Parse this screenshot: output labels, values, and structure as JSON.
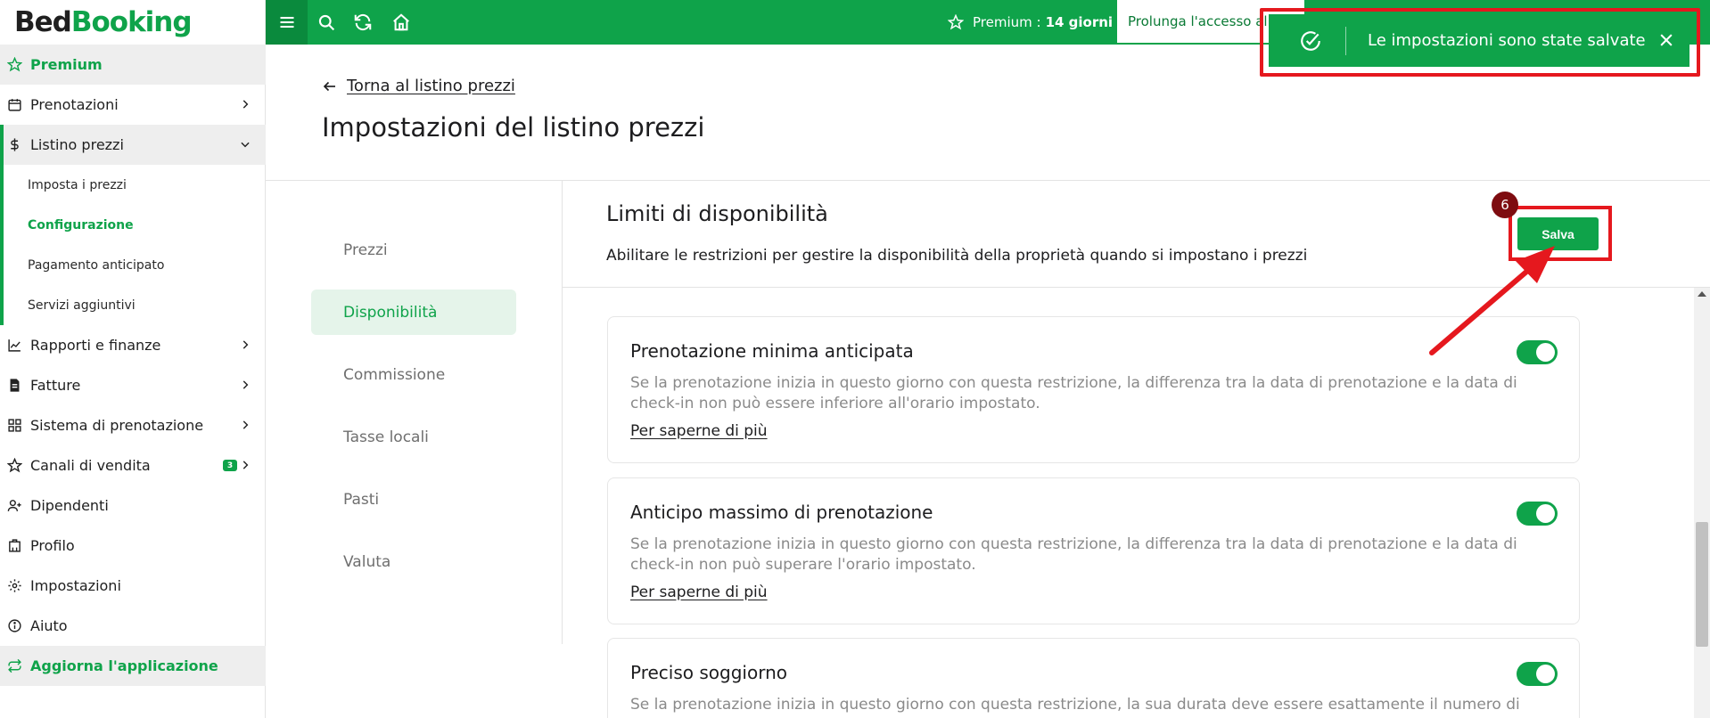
{
  "logo": {
    "part1": "Bed",
    "part2": "Booking"
  },
  "sidebar": {
    "premium": "Premium",
    "items": [
      {
        "label": "Prenotazioni",
        "icon": "calendar-icon"
      },
      {
        "label": "Listino prezzi",
        "icon": "dollar-icon"
      },
      {
        "label": "Rapporti e finanze",
        "icon": "chart-icon"
      },
      {
        "label": "Fatture",
        "icon": "invoice-icon"
      },
      {
        "label": "Sistema di prenotazione",
        "icon": "grid-icon"
      },
      {
        "label": "Canali di vendita",
        "icon": "star-icon",
        "badge": "3"
      },
      {
        "label": "Dipendenti",
        "icon": "user-add-icon"
      },
      {
        "label": "Profilo",
        "icon": "building-icon"
      },
      {
        "label": "Impostazioni",
        "icon": "gear-icon"
      },
      {
        "label": "Aiuto",
        "icon": "info-icon"
      }
    ],
    "subitems": [
      "Imposta i prezzi",
      "Configurazione",
      "Pagamento anticipato",
      "Servizi aggiuntivi"
    ],
    "update": "Aggiorna l'applicazione"
  },
  "topbar": {
    "premium_label": "Premium :",
    "premium_days": "14 giorni",
    "extend_button": "Prolunga l'accesso al co"
  },
  "toast": {
    "message": "Le impostazioni sono state salvate"
  },
  "page": {
    "back_link": "Torna al listino prezzi",
    "title": "Impostazioni del listino prezzi"
  },
  "settings_nav": [
    "Prezzi",
    "Disponibilità",
    "Commissione",
    "Tasse locali",
    "Pasti",
    "Valuta"
  ],
  "section": {
    "title": "Limiti di disponibilità",
    "subtitle": "Abilitare le restrizioni per gestire la disponibilità della proprietà quando si impostano i prezzi",
    "save_button": "Salva",
    "step_number": "6"
  },
  "cards": [
    {
      "title": "Prenotazione minima anticipata",
      "description": "Se la prenotazione inizia in questo giorno con questa restrizione, la differenza tra la data di prenotazione e la data di check-in non può essere inferiore all'orario impostato.",
      "link": "Per saperne di più",
      "enabled": true
    },
    {
      "title": "Anticipo massimo di prenotazione",
      "description": "Se la prenotazione inizia in questo giorno con questa restrizione, la differenza tra la data di prenotazione e la data di check-in non può superare l'orario impostato.",
      "link": "Per saperne di più",
      "enabled": true
    },
    {
      "title": "Preciso soggiorno",
      "description": "Se la prenotazione inizia in questo giorno con questa restrizione, la sua durata deve essere esattamente il numero di",
      "link": "",
      "enabled": true
    }
  ],
  "colors": {
    "brand": "#0fa34a",
    "annotation": "#e5181e",
    "step_badge": "#7e0c10"
  }
}
